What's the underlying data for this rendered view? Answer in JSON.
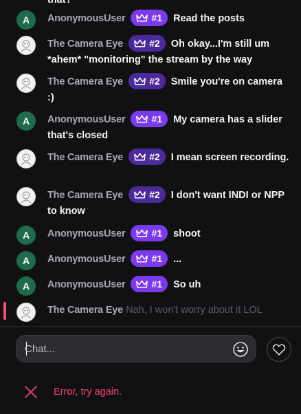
{
  "chat": {
    "partial_line": "that?",
    "messages": [
      {
        "user": "AnonymousUser",
        "avatar_letter": "A",
        "badge": "#1",
        "text": "Read the posts"
      },
      {
        "user": "The Camera Eye",
        "badge": "#2",
        "text": "Oh okay...I'm still um *ahem* \"monitoring\" the stream by the way"
      },
      {
        "user": "The Camera Eye",
        "badge": "#2",
        "text": "Smile you're on camera :)"
      },
      {
        "user": "AnonymousUser",
        "avatar_letter": "A",
        "badge": "#1",
        "text": "My camera has a slider that's closed"
      },
      {
        "user": "The Camera Eye",
        "badge": "#2",
        "text": "I mean screen recording."
      },
      {
        "user": "The Camera Eye",
        "badge": "#2",
        "text": "I don't want INDI or NPP to know"
      },
      {
        "user": "AnonymousUser",
        "avatar_letter": "A",
        "badge": "#1",
        "text": "shoot"
      },
      {
        "user": "AnonymousUser",
        "avatar_letter": "A",
        "badge": "#1",
        "text": "..."
      },
      {
        "user": "AnonymousUser",
        "avatar_letter": "A",
        "badge": "#1",
        "text": "So uh"
      },
      {
        "user": "The Camera Eye",
        "text": "Nah, I won't worry about it LOL",
        "pending": true
      }
    ]
  },
  "input": {
    "placeholder": "Chat..."
  },
  "error": {
    "text": "Error, try again."
  },
  "colors": {
    "badge_primary": "#7c3aed",
    "badge_secondary": "#4c2a9c",
    "anon_avatar": "#1f6b4d",
    "error": "#f0466a",
    "pending_marker": "#ff4d6a"
  },
  "icons": {
    "badge": "crown-icon",
    "emoji": "smiley-icon",
    "react": "heart-icon",
    "error": "close-icon",
    "camera_avatar": "avatar-sketch-icon"
  }
}
